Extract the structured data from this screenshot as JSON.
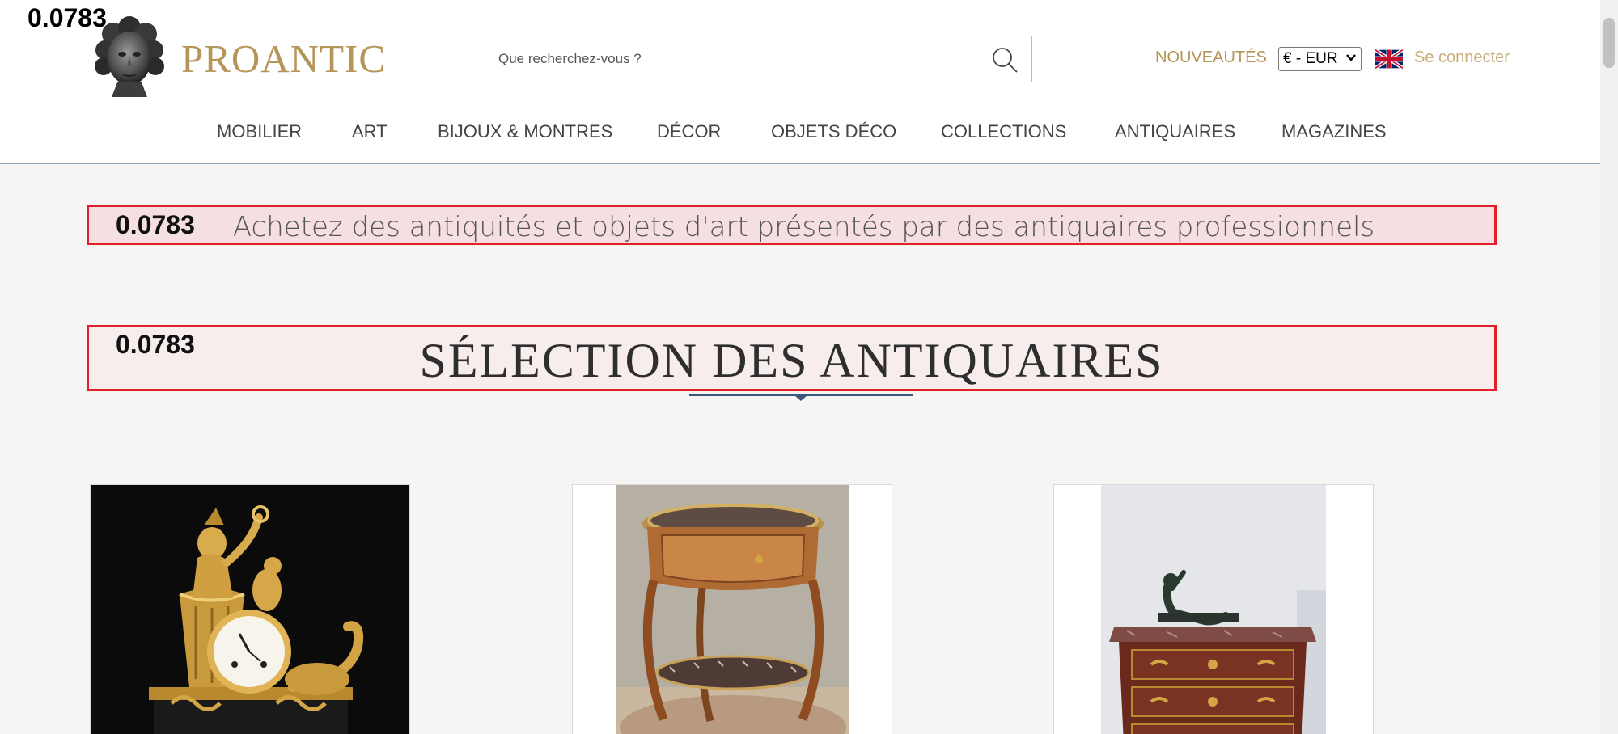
{
  "score_label": "0.0783",
  "header": {
    "logo_text": "PROANTIC",
    "search": {
      "placeholder": "Que recherchez-vous ?",
      "value": ""
    },
    "news_label": "NOUVEAUTÉS",
    "currency": {
      "selected": "€ - EUR"
    },
    "language_flag": "uk-flag-icon",
    "login_label": "Se connecter"
  },
  "nav": {
    "items": [
      {
        "label": "MOBILIER"
      },
      {
        "label": "ART"
      },
      {
        "label": "BIJOUX & MONTRES"
      },
      {
        "label": "DÉCOR"
      },
      {
        "label": "OBJETS DÉCO"
      },
      {
        "label": "COLLECTIONS"
      },
      {
        "label": "ANTIQUAIRES"
      },
      {
        "label": "MAGAZINES"
      }
    ]
  },
  "main": {
    "tagline": "Achetez des antiquités et objets d'art présentés par des antiquaires professionnels",
    "section_title": "SÉLECTION DES ANTIQUAIRES",
    "products": [
      {
        "icon": "gilt-bronze-clock-image"
      },
      {
        "icon": "marquetry-side-table-image"
      },
      {
        "icon": "commode-with-bronze-figure-image"
      }
    ]
  },
  "colors": {
    "brand_gold": "#b59558",
    "highlight_border": "#e0202a",
    "nav_text": "#444444",
    "page_background": "#f6f5f3"
  }
}
